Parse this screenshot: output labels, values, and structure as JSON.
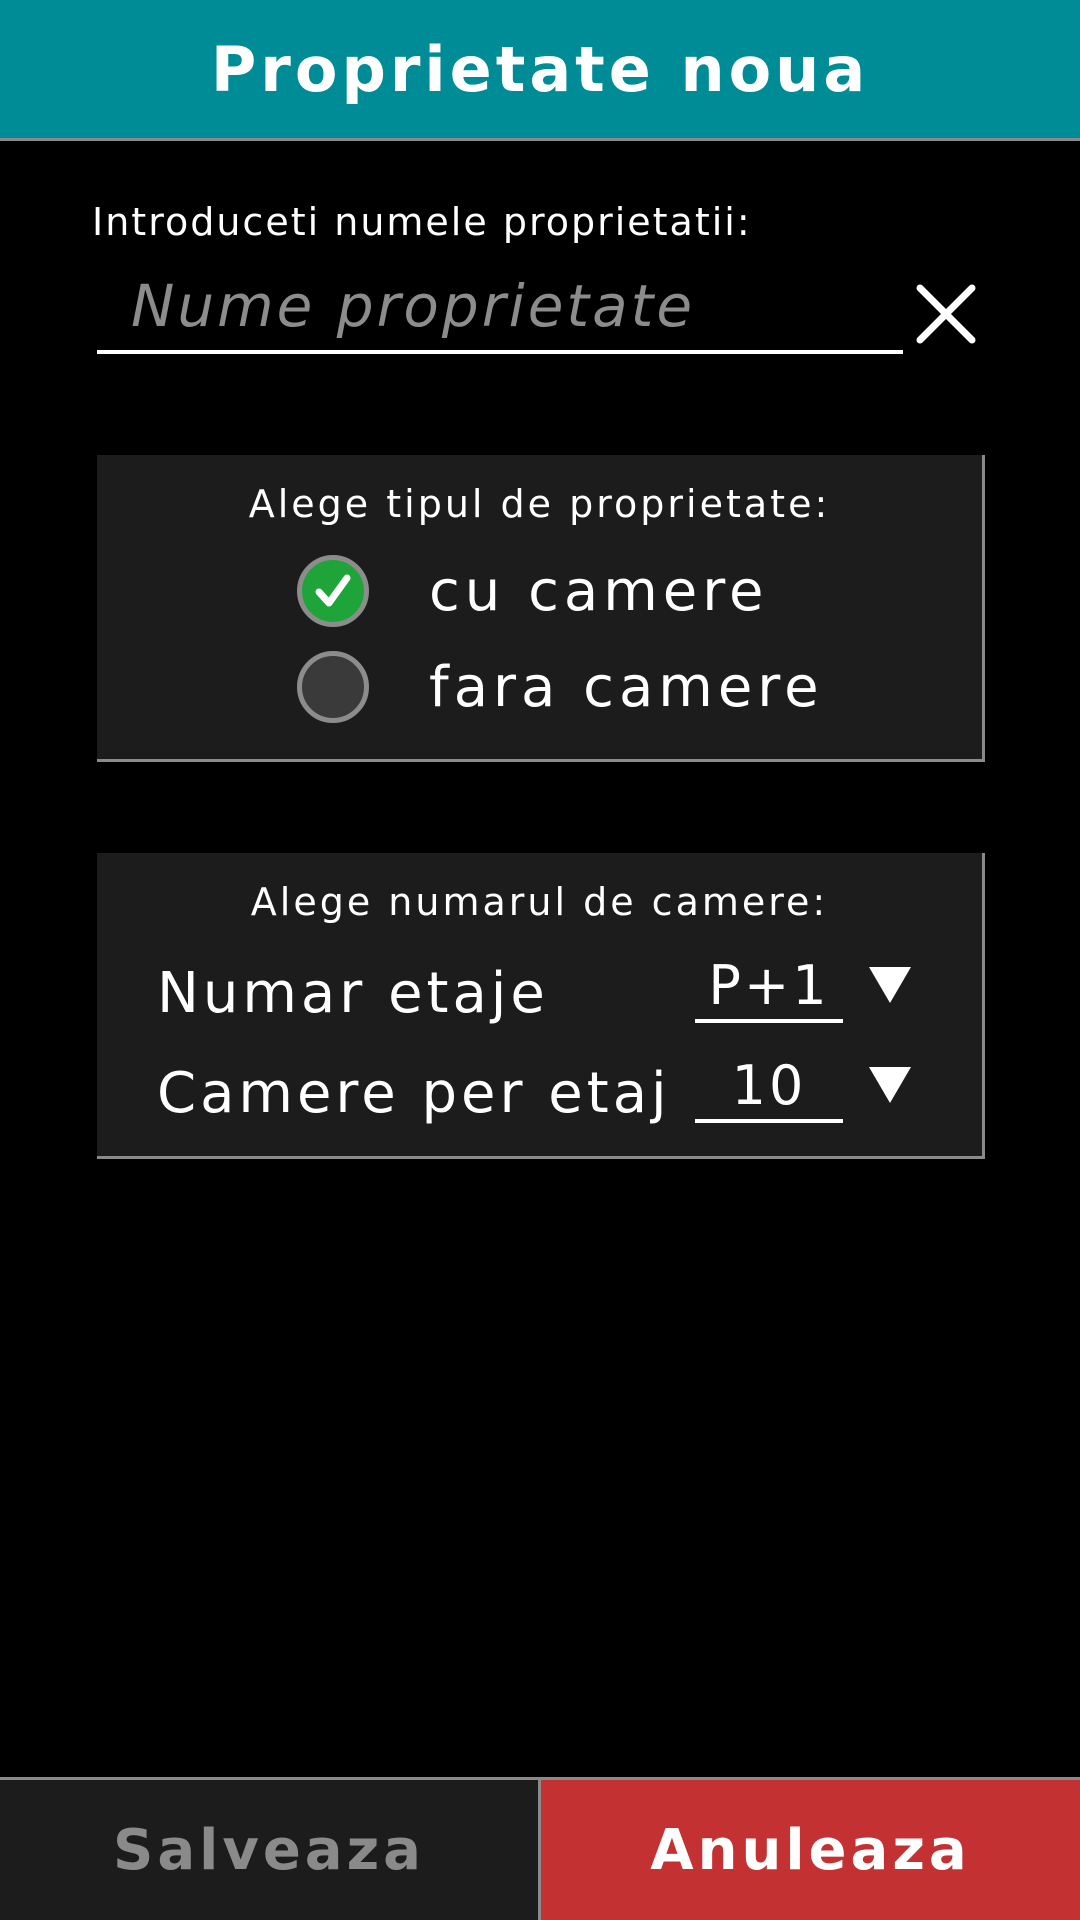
{
  "header": {
    "title": "Proprietate noua",
    "background_color": "#008c96"
  },
  "name_field": {
    "label": "Introduceti numele proprietatii:",
    "placeholder": "Nume proprietate",
    "value": "",
    "clear_icon": "close-icon"
  },
  "property_type": {
    "title": "Alege tipul de proprietate:",
    "options": [
      {
        "label": "cu camere",
        "selected": true
      },
      {
        "label": "fara camere",
        "selected": false
      }
    ],
    "selected_color": "#1fa43a"
  },
  "rooms": {
    "title": "Alege numarul de camere:",
    "rows": [
      {
        "label": "Numar etaje",
        "value": "P+1",
        "icon": "triangle-down-icon"
      },
      {
        "label": "Camere per etaj",
        "value": "10",
        "icon": "triangle-down-icon"
      }
    ]
  },
  "actions": {
    "save_label": "Salveaza",
    "cancel_label": "Anuleaza",
    "cancel_color": "#c33133"
  }
}
